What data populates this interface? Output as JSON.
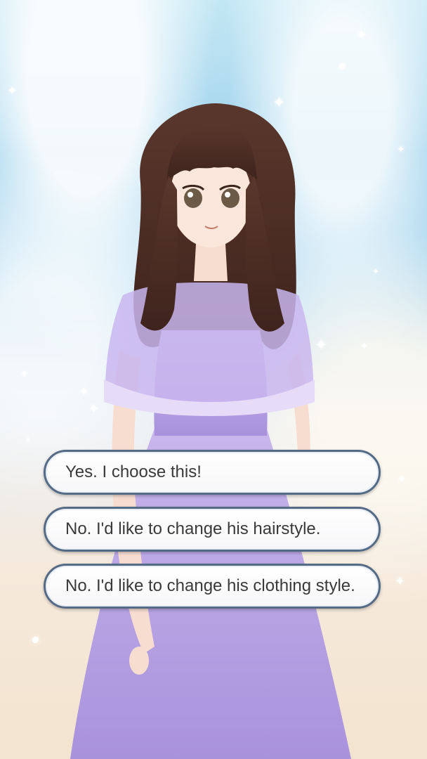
{
  "choices": [
    {
      "label": "Yes. I choose this!"
    },
    {
      "label": "No. I'd like to change his hairstyle."
    },
    {
      "label": "No. I'd like to change his clothing style."
    }
  ],
  "colors": {
    "button_border": "#556b85",
    "button_fill": "#ffffff",
    "text": "#3a3a3a",
    "dress": "#b8a3e3",
    "hair": "#4a2c25"
  },
  "scene": {
    "character_icon": "anime-girl-in-lavender-dress",
    "background_icon": "sky-bokeh-background"
  }
}
